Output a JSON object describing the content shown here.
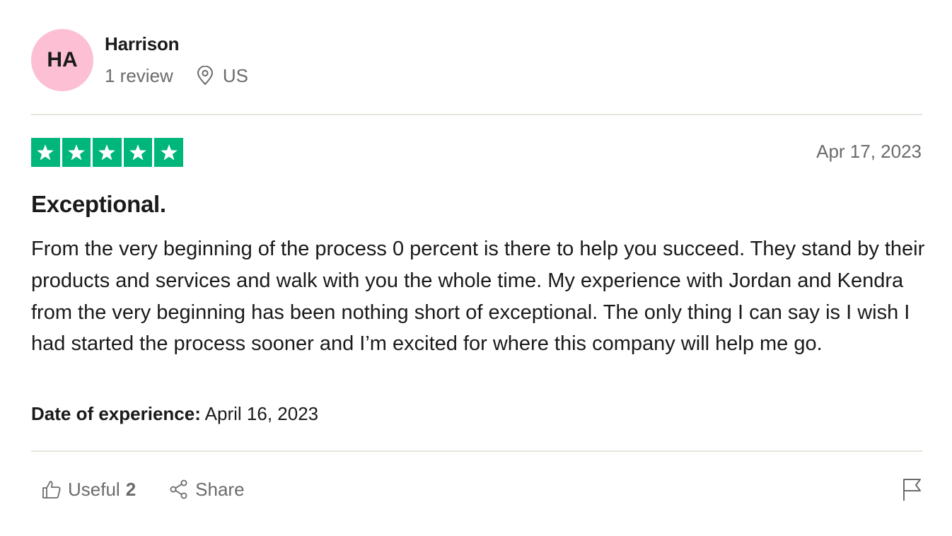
{
  "consumer": {
    "initials": "HA",
    "name": "Harrison",
    "review_count": "1 review",
    "location": "US",
    "avatar_color": "#fcbfd3"
  },
  "review": {
    "rating": 5,
    "rating_max": 5,
    "star_color": "#00b67a",
    "date": "Apr 17, 2023",
    "title": "Exceptional.",
    "body": "From the very beginning of the process 0 percent is there to help you succeed. They stand by their products and services and walk with you the whole time. My experience with Jordan and Kendra from the very beginning has been nothing short of exceptional. The only thing I can say is I wish I had started the process sooner and I’m excited for where this company will help me go.",
    "date_of_experience_label": "Date of experience:",
    "date_of_experience": "April 16, 2023"
  },
  "actions": {
    "useful_label": "Useful",
    "useful_count": "2",
    "share_label": "Share"
  },
  "icons": {
    "location": "location-pin-icon",
    "useful": "thumbs-up-icon",
    "share": "share-icon",
    "report": "flag-icon",
    "star": "star-icon"
  }
}
